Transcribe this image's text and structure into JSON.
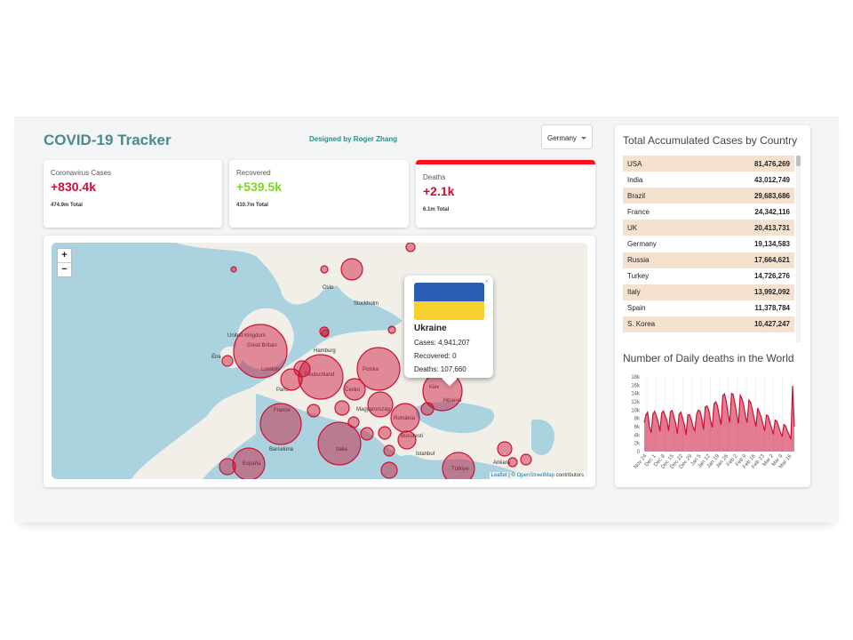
{
  "header": {
    "title": "COVID-19 Tracker",
    "designer": "Designed by Roger Zhang",
    "country_select": "Germany"
  },
  "cards": [
    {
      "label": "Coronavirus Cases",
      "value": "+830.4k",
      "total": "474.9m Total",
      "color": "#cc1034"
    },
    {
      "label": "Recovered",
      "value": "+539.5k",
      "total": "410.7m Total",
      "color": "#7dd71d"
    },
    {
      "label": "Deaths",
      "value": "+2.1k",
      "total": "6.1m Total",
      "color": "#cc1034"
    }
  ],
  "map": {
    "zoom_in": "+",
    "zoom_out": "−",
    "popup": {
      "country": "Ukraine",
      "cases": "Cases: 4,941,207",
      "recovered": "Recovered: 0",
      "deaths": "Deaths: 107,660",
      "close": "×"
    },
    "attribution": {
      "leaflet": "Leaflet",
      "sep": " | © ",
      "osm": "OpenStreetMap",
      "rest": " contributors"
    },
    "labels": [
      "Oslo",
      "Stockholm",
      "United Kingdom",
      "Great Britain",
      "Éire",
      "London",
      "Hamburg",
      "Deutschland",
      "Polska",
      "Paris",
      "Česko",
      "France",
      "Magyarország",
      "România",
      "Україна",
      "Kiev",
      "Bucuresti",
      "Barcelona",
      "España",
      "Italia",
      "Türkiye",
      "Istanbul",
      "Ankara"
    ]
  },
  "sidebar": {
    "table_title": "Total Accumulated Cases by Country",
    "rows": [
      {
        "country": "USA",
        "cases": "81,476,269"
      },
      {
        "country": "India",
        "cases": "43,012,749"
      },
      {
        "country": "Brazil",
        "cases": "29,683,686"
      },
      {
        "country": "France",
        "cases": "24,342,116"
      },
      {
        "country": "UK",
        "cases": "20,413,731"
      },
      {
        "country": "Germany",
        "cases": "19,134,583"
      },
      {
        "country": "Russia",
        "cases": "17,664,621"
      },
      {
        "country": "Turkey",
        "cases": "14,726,276"
      },
      {
        "country": "Italy",
        "cases": "13,992,092"
      },
      {
        "country": "Spain",
        "cases": "11,378,784"
      },
      {
        "country": "S. Korea",
        "cases": "10,427,247"
      }
    ],
    "chart_title": "Number of Daily deaths in the World"
  },
  "chart_data": {
    "type": "area",
    "title": "Number of Daily deaths in the World",
    "ylim": [
      0,
      18000
    ],
    "yticks": [
      "0",
      "2k",
      "4k",
      "6k",
      "8k",
      "10k",
      "12k",
      "14k",
      "16k",
      "18k"
    ],
    "xticks": [
      "Nov 24",
      "Dec 1",
      "Dec 8",
      "Dec 15",
      "Dec 22",
      "Dec 29",
      "Jan 5",
      "Jan 12",
      "Jan 19",
      "Jan 26",
      "Feb 2",
      "Feb 9",
      "Feb 16",
      "Feb 23",
      "Mar 2",
      "Mar 9",
      "Mar 16"
    ],
    "values": [
      7000,
      8800,
      9500,
      6000,
      4500,
      9000,
      9700,
      8500,
      7200,
      4900,
      9300,
      9800,
      8600,
      7600,
      5000,
      9600,
      9900,
      8400,
      6800,
      4300,
      9000,
      9500,
      8000,
      6500,
      4000,
      8800,
      8900,
      7600,
      6000,
      5000,
      9000,
      10000,
      9700,
      8000,
      5300,
      10800,
      11000,
      10000,
      7500,
      5800,
      11500,
      12000,
      11000,
      8500,
      6500,
      13500,
      13900,
      12000,
      9200,
      7000,
      14000,
      13800,
      11500,
      8900,
      6800,
      13600,
      12800,
      11200,
      8500,
      7000,
      12400,
      11800,
      10000,
      8000,
      6000,
      10500,
      9500,
      8300,
      6600,
      5000,
      8800,
      8600,
      7000,
      5600,
      4200,
      7600,
      7300,
      6000,
      4700,
      3600,
      6500,
      6200,
      5000,
      4000,
      3000,
      15800,
      6000
    ],
    "colors": {
      "line": "#cc1034",
      "fill": "rgba(204,16,52,0.55)"
    }
  }
}
